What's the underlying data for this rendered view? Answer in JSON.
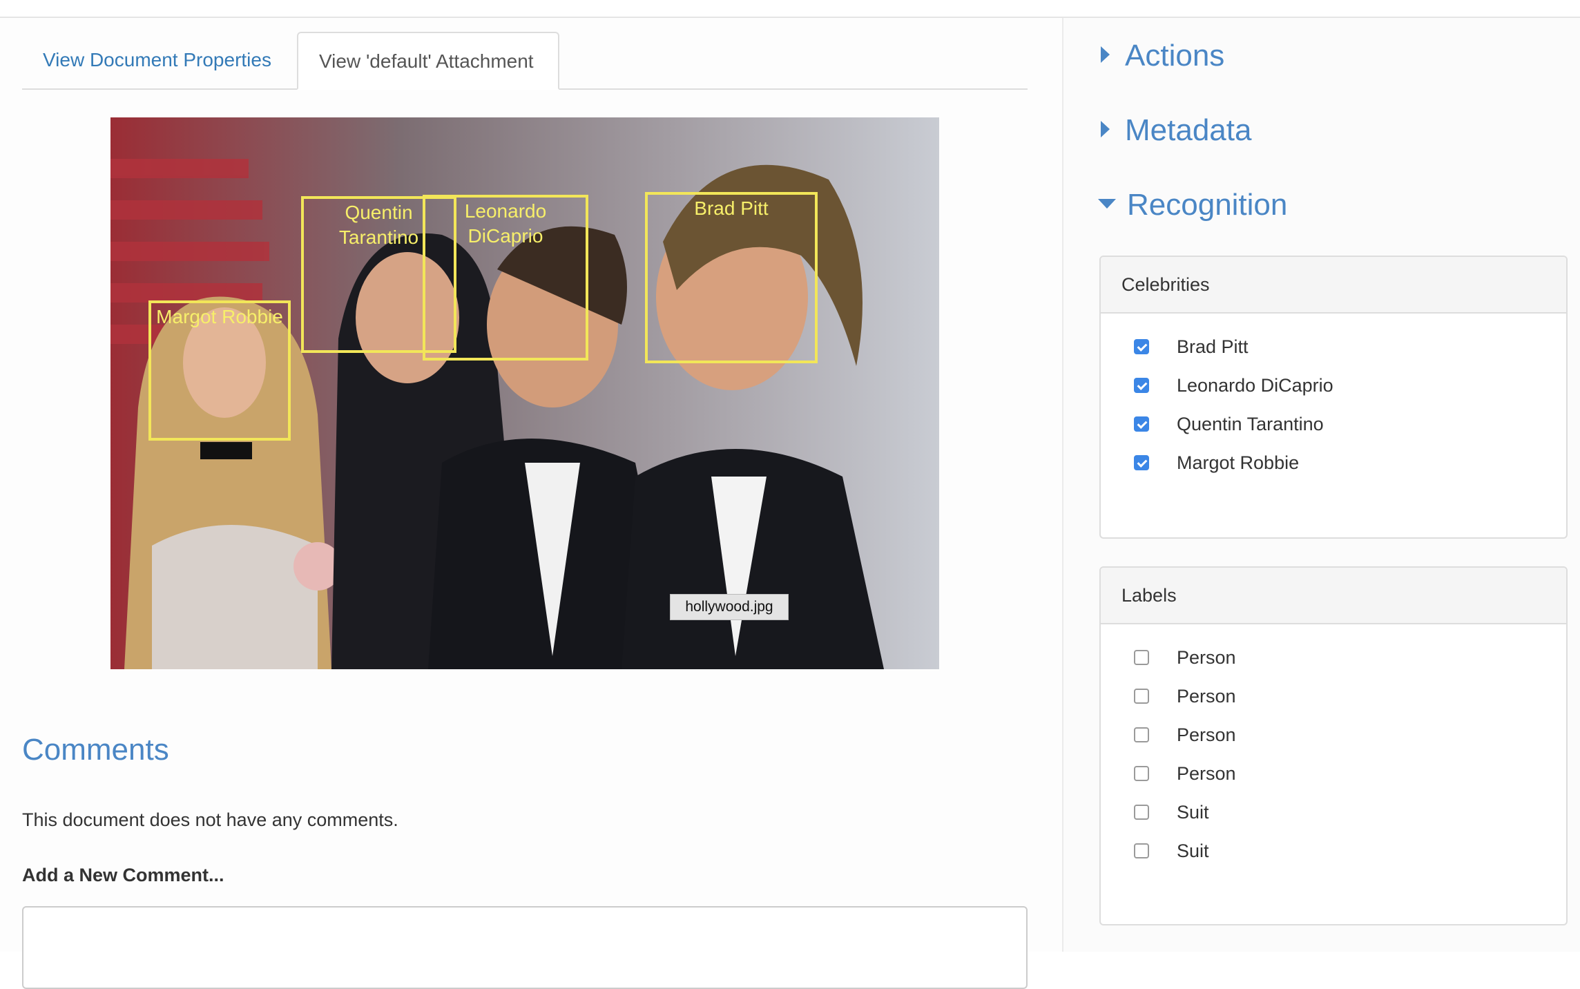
{
  "tabs": {
    "properties": "View Document Properties",
    "attachment": "View 'default' Attachment"
  },
  "attachment": {
    "filename": "hollywood.jpg",
    "faces": [
      {
        "label": "Quentin\nTarantino"
      },
      {
        "label": "Leonardo\nDiCaprio"
      },
      {
        "label": "Brad Pitt"
      },
      {
        "label": "Margot Robbie"
      }
    ]
  },
  "comments": {
    "title": "Comments",
    "empty_text": "This document does not have any comments.",
    "add_label": "Add a New Comment..."
  },
  "sidebar": {
    "actions": "Actions",
    "metadata": "Metadata",
    "recognition": "Recognition",
    "celebrities": {
      "title": "Celebrities",
      "items": [
        {
          "label": "Brad Pitt",
          "checked": true
        },
        {
          "label": "Leonardo DiCaprio",
          "checked": true
        },
        {
          "label": "Quentin Tarantino",
          "checked": true
        },
        {
          "label": "Margot Robbie",
          "checked": true
        }
      ]
    },
    "labels": {
      "title": "Labels",
      "items": [
        {
          "label": "Person",
          "checked": false
        },
        {
          "label": "Person",
          "checked": false
        },
        {
          "label": "Person",
          "checked": false
        },
        {
          "label": "Person",
          "checked": false
        },
        {
          "label": "Suit",
          "checked": false
        },
        {
          "label": "Suit",
          "checked": false
        }
      ]
    }
  },
  "colors": {
    "link": "#337ab7",
    "heading": "#4a86c5",
    "face_box": "#f2e659",
    "checkbox_on": "#3b86e6"
  }
}
